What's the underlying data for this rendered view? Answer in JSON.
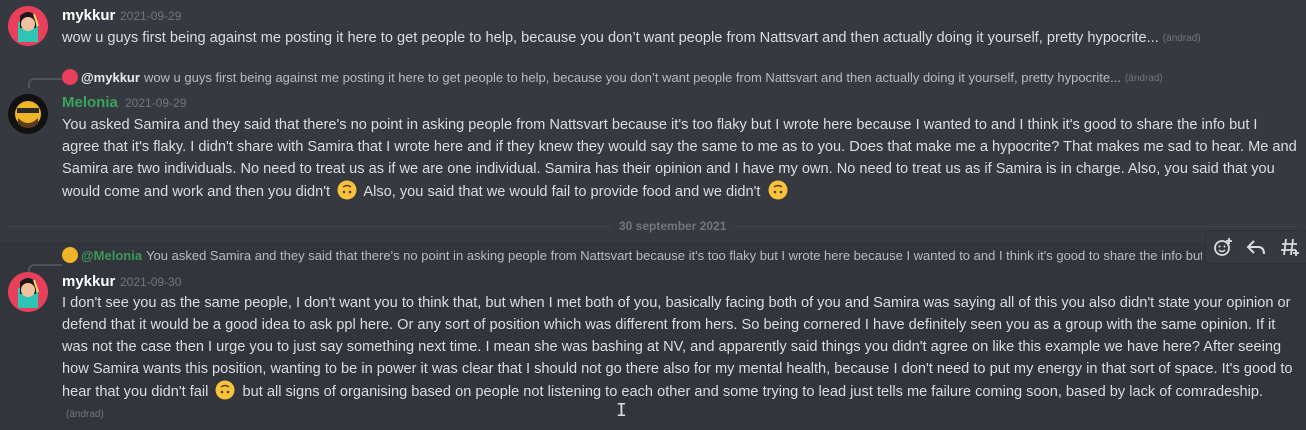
{
  "messages": [
    {
      "author": "mykkur",
      "timestamp": "2021-09-29",
      "text": "wow u guys first being against me posting it here to get people to help, because you don’t want people from Nattsvart and then actually doing it yourself, pretty hypocrite...",
      "edited": "(ändrad)"
    },
    {
      "reply": {
        "author": "@mykkur",
        "text": "wow u guys first being against me posting it here to get people to help, because you don’t want people from Nattsvart and then actually doing it yourself, pretty hypocrite...",
        "edited": "(ändrad)"
      },
      "author": "Melonia",
      "timestamp": "2021-09-29",
      "text_part1": "You asked Samira and they said that there's no point in asking people from Nattsvart because it's too flaky but I wrote here because I wanted to and I think it's good to share the info but I agree that it's flaky. I didn't share with Samira that I wrote here and if they knew they would say the same to me as to you. Does that make me a hypocrite? That makes me sad to hear. Me and Samira are two individuals. No need to treat us as if we are one individual. Samira has their opinion and I have my own. No need to treat us as if Samira is in charge. Also, you said that you would come and work and then you didn't",
      "text_part2": "Also, you said that we would fail to provide food and we didn't"
    },
    {
      "reply": {
        "author": "@Melonia",
        "text": "You asked Samira and they said that there's no point in asking people from Nattsvart because it's too flaky but I wrote here because I wanted to and I think it's good to share the info but I agree that it is fl..."
      },
      "author": "mykkur",
      "timestamp": "2021-09-30",
      "text_part1": "I don't see you as the same people, I don't want you to think that, but when I met both of you, basically facing both of you and Samira was saying all of this you also didn't state your opinion or defend that it would be a good idea to ask ppl here. Or any sort of position which was different from hers. So being cornered I have definitely seen you as a group with the same opinion. If it was not the case then I urge you to just say something next time. I mean she was bashing at NV, and apparently said things you didn't agree on like this example we have here? After seeing how Samira wants this position, wanting to be in power it was clear that I should not go there also for my mental health, because I don't need to put my energy in that sort of space. It's good to hear that you didn't fail",
      "text_part2": "but all signs of organising based on people not listening to each other and some trying to lead just tells me failure coming soon, based by lack of comradeship.",
      "edited": "(ändrad)"
    }
  ],
  "divider_date": "30 september 2021",
  "toolbar": {
    "icons": [
      "add-reaction-icon",
      "reply-icon",
      "create-thread-icon"
    ]
  },
  "colors": {
    "background": "#36393f",
    "hover": "#32353b",
    "green_name": "#3ba55d",
    "timestamp": "#72767d"
  }
}
